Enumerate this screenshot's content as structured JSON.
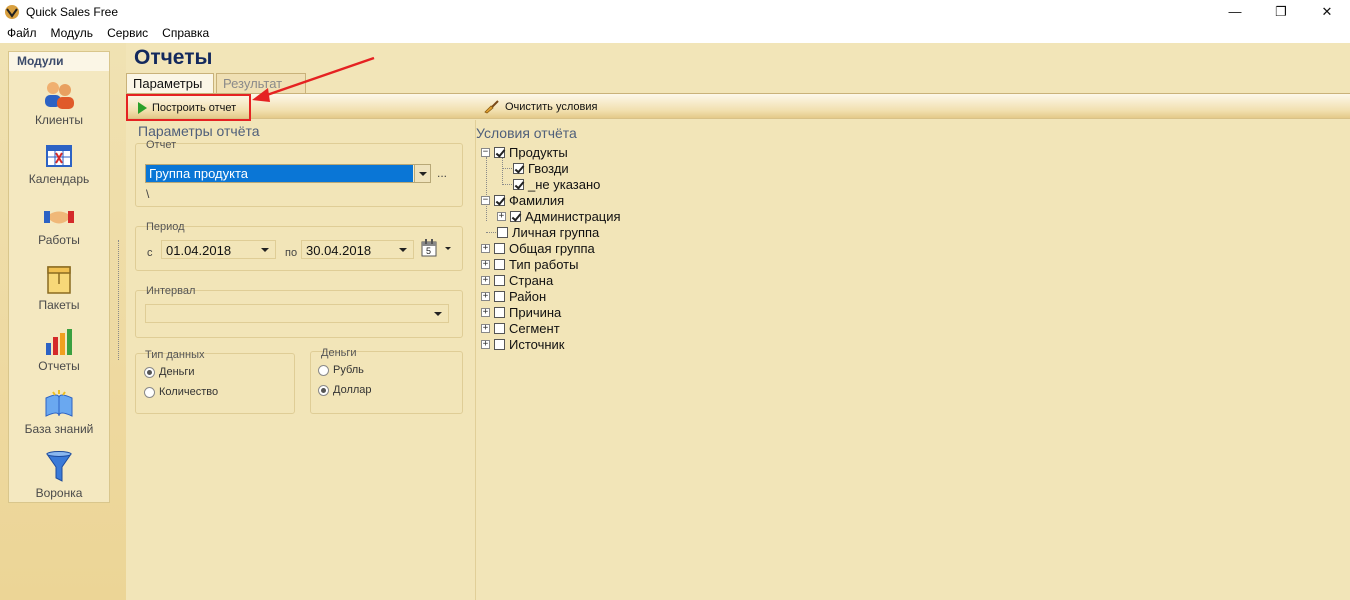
{
  "window": {
    "title": "Quick Sales Free",
    "controls": [
      "—",
      "❐",
      "✕"
    ]
  },
  "menu": [
    "Файл",
    "Модуль",
    "Сервис",
    "Справка"
  ],
  "modules": {
    "header": "Модули",
    "items": [
      {
        "label": "Клиенты",
        "icon": "clients-icon"
      },
      {
        "label": "Календарь",
        "icon": "calendar-icon"
      },
      {
        "label": "Работы",
        "icon": "handshake-icon"
      },
      {
        "label": "Пакеты",
        "icon": "package-icon"
      },
      {
        "label": "Отчеты",
        "icon": "bar-chart-icon"
      },
      {
        "label": "База знаний",
        "icon": "book-icon"
      },
      {
        "label": "Воронка",
        "icon": "funnel-icon"
      }
    ]
  },
  "page": {
    "title": "Отчеты"
  },
  "tabs": {
    "params": "Параметры",
    "results": "Результат"
  },
  "toolbar": {
    "build": "Построить отчет",
    "clear": "Очистить условия"
  },
  "params": {
    "title": "Параметры отчёта",
    "report_label": "Отчет",
    "report_value": "Группа продукта",
    "report_ellipsis": "...",
    "report_path": "\\",
    "period_label": "Период",
    "from_label": "с",
    "from_date": "01.04.2018",
    "to_label": "по",
    "to_date": "30.04.2018",
    "calendar_day": "5",
    "interval_label": "Интервал",
    "datatype_label": "Тип данных",
    "datatype_money": "Деньги",
    "datatype_qty": "Количество",
    "money_label": "Деньги",
    "money_rub": "Рубль",
    "money_usd": "Доллар"
  },
  "conditions": {
    "title": "Условия отчёта",
    "tree": {
      "products": "Продукты",
      "nails": "Гвозди",
      "not_specified": "_не указано",
      "surname": "Фамилия",
      "admin": "Администрация",
      "personal_group": "Личная группа",
      "general_group": "Общая группа",
      "work_type": "Тип работы",
      "country": "Страна",
      "district": "Район",
      "reason": "Причина",
      "segment": "Сегмент",
      "source": "Источник"
    }
  },
  "colors": {
    "accent_red": "#e52222",
    "title_blue": "#13295d",
    "selection": "#0a76d6"
  }
}
